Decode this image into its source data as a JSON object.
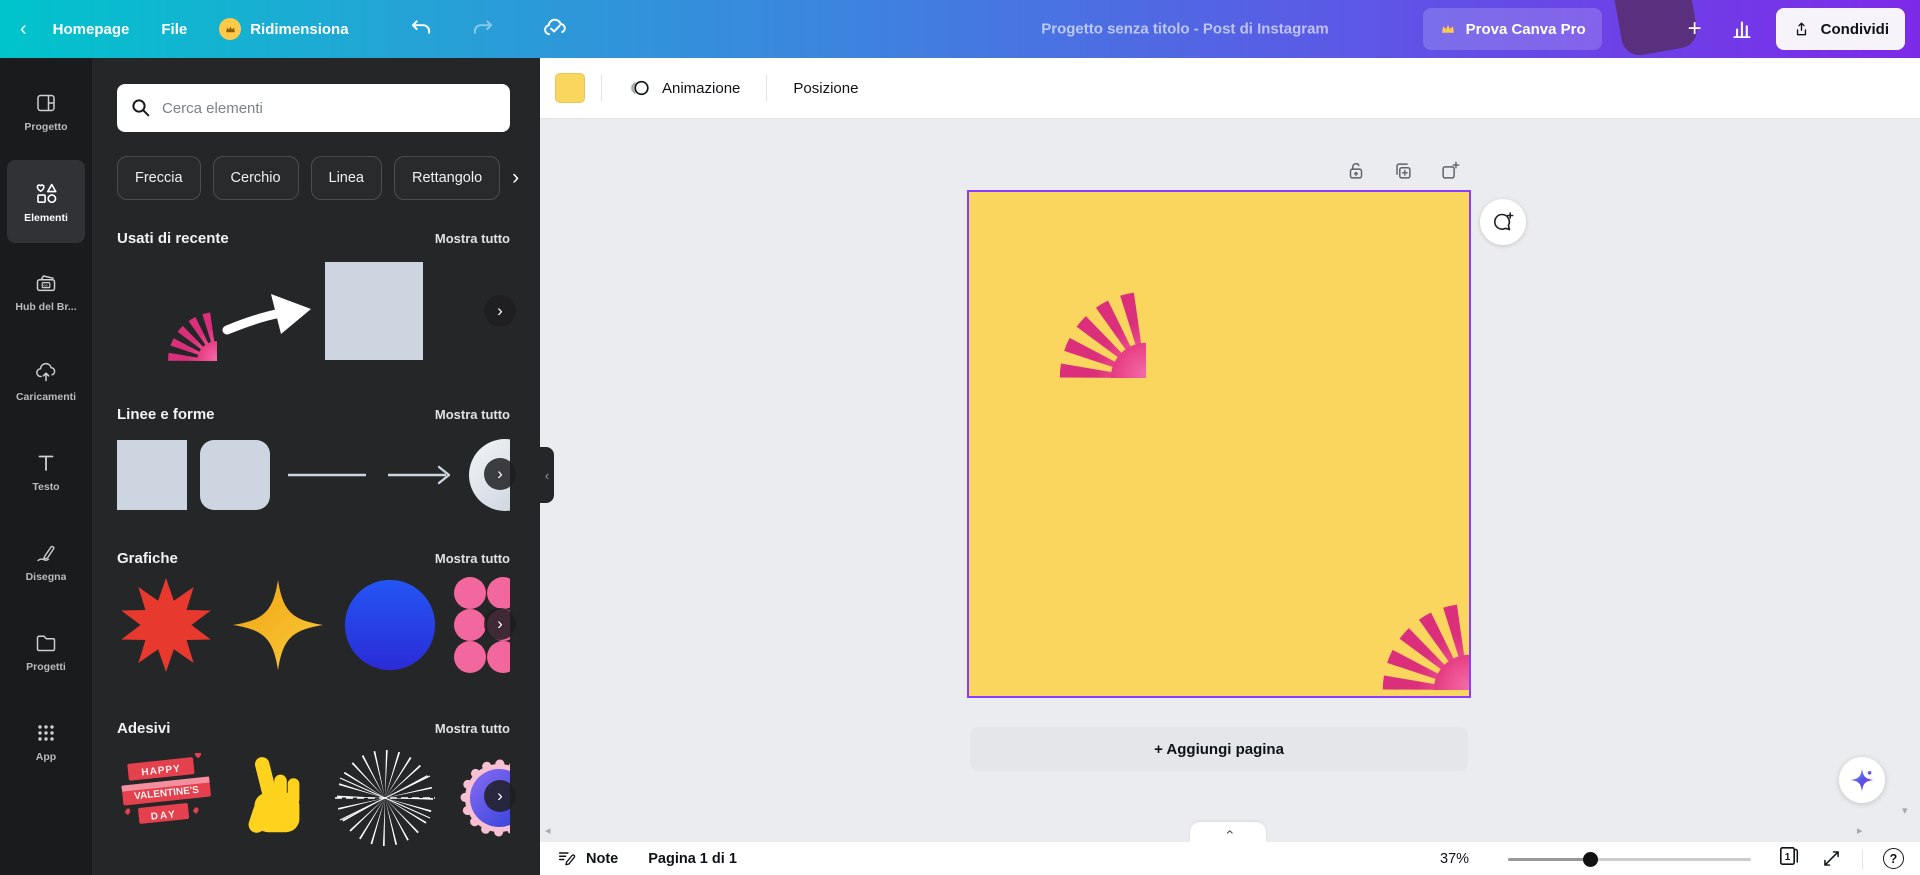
{
  "topbar": {
    "homepage_label": "Homepage",
    "file_label": "File",
    "resize_label": "Ridimensiona",
    "title": "Progetto senza titolo - Post di Instagram",
    "pro_button_label": "Prova Canva Pro",
    "share_button_label": "Condividi"
  },
  "sidebar": {
    "items": [
      {
        "label": "Progetto"
      },
      {
        "label": "Elementi"
      },
      {
        "label": "Hub del Br..."
      },
      {
        "label": "Caricamenti"
      },
      {
        "label": "Testo"
      },
      {
        "label": "Disegna"
      },
      {
        "label": "Progetti"
      },
      {
        "label": "App"
      }
    ]
  },
  "panel": {
    "search_placeholder": "Cerca elementi",
    "chips": [
      {
        "label": "Freccia"
      },
      {
        "label": "Cerchio"
      },
      {
        "label": "Linea"
      },
      {
        "label": "Rettangolo"
      }
    ],
    "sections": [
      {
        "title": "Usati di recente",
        "action": "Mostra tutto"
      },
      {
        "title": "Linee e forme",
        "action": "Mostra tutto"
      },
      {
        "title": "Grafiche",
        "action": "Mostra tutto"
      },
      {
        "title": "Adesivi",
        "action": "Mostra tutto"
      }
    ],
    "valentine_sticker": {
      "line1": "HAPPY",
      "line2": "VALENTINE'S",
      "line3": "DAY"
    }
  },
  "toolbar": {
    "animation_label": "Animazione",
    "position_label": "Posizione",
    "fill_color": "#FAD65E"
  },
  "canvas": {
    "add_page_label": "+ Aggiungi pagina"
  },
  "statusbar": {
    "notes_label": "Note",
    "page_indicator": "Pagina 1 di 1",
    "zoom_level": "37%",
    "page_badge": "1",
    "help_glyph": "?"
  },
  "icons": {
    "back": "‹",
    "chevron_right": "›",
    "chevron_left": "‹",
    "plus": "+",
    "scroll_up": "▴",
    "scroll_down": "▾",
    "scroll_left": "◂",
    "scroll_right": "▸"
  },
  "colors": {
    "topbar_gradient_start": "#00C4CC",
    "topbar_gradient_end": "#7D2AE8",
    "accent_purple": "#8B3DFF",
    "page_yellow": "#FAD65E",
    "starburst_pink": "#EE4D8D",
    "panel_bg": "#252627",
    "sidebar_bg": "#1A1B1D"
  }
}
